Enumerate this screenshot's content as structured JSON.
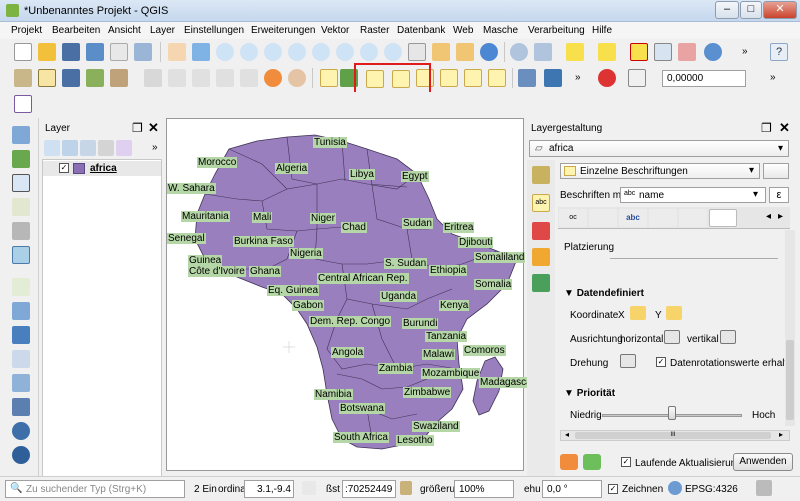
{
  "window": {
    "title": "*Unbenanntes Projekt - QGIS",
    "minimize": "–",
    "maximize": "□",
    "close": "✕"
  },
  "menu": [
    "Projekt",
    "Bearbeiten",
    "Ansicht",
    "Layer",
    "Einstellungen",
    "Erweiterungen",
    "Vektor",
    "Raster",
    "Datenbank",
    "Web",
    "Masche",
    "Verarbeitung",
    "Hilfe"
  ],
  "toolbar": {
    "scale_value": "0,00000",
    "overflow": "»",
    "help": "?"
  },
  "layers_panel": {
    "title": "Layer",
    "layer_name": "africa",
    "overflow": "»"
  },
  "map": {
    "countries": [
      "Tunisia",
      "Morocco",
      "Algeria",
      "Libya",
      "Egypt",
      "W. Sahara",
      "Mauritania",
      "Mali",
      "Niger",
      "Chad",
      "Sudan",
      "Eritrea",
      "Senegal",
      "Burkina Faso",
      "Djibouti",
      "Guinea",
      "Nigeria",
      "S. Sudan",
      "Somaliland",
      "Côte d'Ivoire",
      "Ghana",
      "Central African Rep.",
      "Ethiopia",
      "Somalia",
      "Eq. Guinea",
      "Uganda",
      "Gabon",
      "Kenya",
      "Dem. Rep. Congo",
      "Burundi",
      "Tanzania",
      "Angola",
      "Malawi",
      "Comoros",
      "Zambia",
      "Mozambique",
      "Madagascar",
      "Zimbabwe",
      "Namibia",
      "Botswana",
      "Swaziland",
      "South Africa",
      "Lesotho"
    ]
  },
  "style_panel": {
    "title": "Layergestaltung",
    "layer_select": "africa",
    "mode_select": "Einzelne Beschriftungen",
    "label_with": "Beschriften mit",
    "field_prefix": "abc",
    "field_name": "name",
    "placement_label": "Platzierung",
    "data_defined_header": "Datendefiniert",
    "coordinate_label": "Koordinate",
    "x_label": "X",
    "y_label": "Y",
    "alignment_label": "Ausrichtung",
    "horizontal_label": "horizontal",
    "vertical_label": "vertikal",
    "rotation_label": "Drehung",
    "rotation_checkbox": "Datenrotationswerte erhalte",
    "priority_header": "Priorität",
    "low_label": "Niedrig",
    "high_label": "Hoch",
    "slider_value": 0.5,
    "live_update": "Laufende Aktualisierung",
    "apply_button": "Anwenden",
    "scroll_center": "III"
  },
  "status": {
    "search_placeholder": "Zu suchender Typ (Strg+K)",
    "legend_count": "2 Ein",
    "coord_label": "ordina",
    "coord_value": "3.1,-9.4",
    "scale_label": "ßst",
    "scale_value": ":70252449",
    "magnifier_label": "größeru",
    "magnifier_value": "100%",
    "rotation_label": "ehu",
    "rotation_value": "0,0 °",
    "render_label": "Zeichnen",
    "crs": "EPSG:4326"
  }
}
